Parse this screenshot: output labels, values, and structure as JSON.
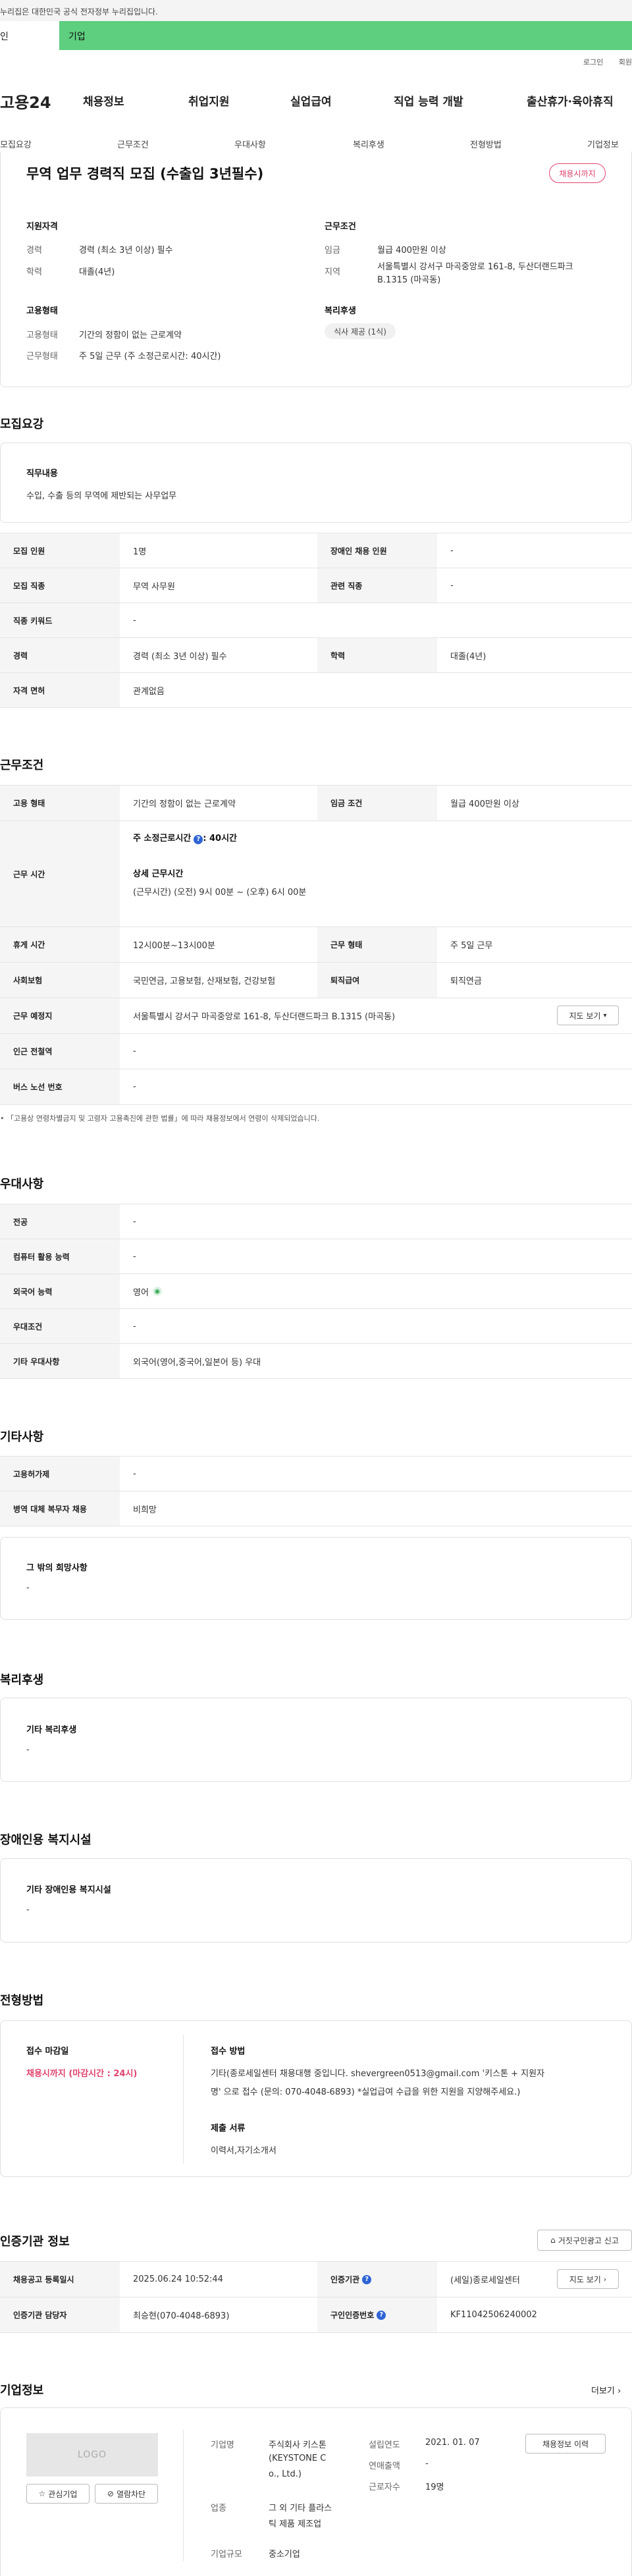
{
  "top": {
    "notice": "이 누리집은 대한민국 공식 전자정부 누리집입니다.",
    "notice_visible": "누리집은 대한민국 공식 전자정부 누리집입니다.",
    "tab_left": "인",
    "tab_right": "기업"
  },
  "util": {
    "login": "로그인",
    "join": "회원"
  },
  "logo": "고용24",
  "gnb": [
    "채용정보",
    "취업지원",
    "실업급여",
    "직업 능력 개발",
    "출산휴가·육아휴직"
  ],
  "subnav": [
    "모집요강",
    "근무조건",
    "우대사항",
    "복리후생",
    "전형방법",
    "기업정보"
  ],
  "summary": {
    "title": "무역 업무 경력직 모집 (수출입 3년필수)",
    "badge": "채용시까지",
    "qual_title": "지원자격",
    "career_lbl": "경력",
    "career_val": "경력 (최소 3년 이상) 필수",
    "edu_lbl": "학력",
    "edu_val": "대졸(4년)",
    "work_title": "근무조건",
    "wage_lbl": "임금",
    "wage_val": "월급 400만원 이상",
    "region_lbl": "지역",
    "region_val1": "서울특별시 강서구 마곡중앙로 161-8, 두산더랜드파크",
    "region_val2": "B.1315 (마곡동)",
    "emp_title": "고용형태",
    "emp_lbl": "고용형태",
    "emp_val": "기간의 정함이 없는 근로계약",
    "shape_lbl": "근무형태",
    "shape_val": "주 5일 근무 (주 소정근로시간: 40시간)",
    "welfare_title": "복리후생",
    "welfare_chip": "식사 제공 (1식)"
  },
  "recruit": {
    "title": "모집요강",
    "duty_title": "직무내용",
    "duty_val": "수입, 수출 등의 무역에 제반되는 사무업무",
    "rows": [
      {
        "th1": "모집 인원",
        "td1": "1명",
        "th2": "장애인 채용 인원",
        "td2": "-"
      },
      {
        "th1": "모집 직종",
        "td1": "무역 사무원",
        "th2": "관련 직종",
        "td2": "-"
      },
      {
        "th1": "직종 키워드",
        "td1": "-"
      },
      {
        "th1": "경력",
        "td1": "경력 (최소 3년 이상) 필수",
        "th2": "학력",
        "td2": "대졸(4년)"
      },
      {
        "th1": "자격 면허",
        "td1": "관계없음"
      }
    ]
  },
  "work": {
    "title": "근무조건",
    "emp_th": "고용 형태",
    "emp_td": "기간의 정함이 없는 근로계약",
    "wage_th": "임금 조건",
    "wage_td": "월급 400만원 이상",
    "time_th": "근무 시간",
    "time_label": "주 소정근로시간",
    "time_val": ": 40시간",
    "detail_label": "상세 근무시간",
    "detail_val": "(근무시간) (오전) 9시 00분 ~ (오후) 6시 00분",
    "rest_th": "휴게 시간",
    "rest_td": "12시00분~13시00분",
    "shape_th": "근무 형태",
    "shape_td": "주 5일 근무",
    "ins_th": "사회보험",
    "ins_td": "국민연금, 고용보험, 산재보험, 건강보험",
    "ret_th": "퇴직급여",
    "ret_td": "퇴직연금",
    "place_th": "근무 예정지",
    "place_td": "서울특별시 강서구 마곡중앙로 161-8, 두산더랜드파크 B.1315 (마곡동)",
    "map_btn": "지도 보기",
    "subway_th": "인근 전철역",
    "subway_td": "-",
    "bus_th": "버스 노선 번호",
    "bus_td": "-",
    "note": "「고용상 연령차별금지 및 고령자 고용촉진에 관한 법률」에 따라 채용정보에서 연령이 삭제되었습니다."
  },
  "pref": {
    "title": "우대사항",
    "rows": [
      {
        "th": "전공",
        "td": "-"
      },
      {
        "th": "컴퓨터 활용 능력",
        "td": "-"
      },
      {
        "th": "외국어 능력",
        "td": "영어"
      },
      {
        "th": "우대조건",
        "td": "-"
      },
      {
        "th": "기타 우대사항",
        "td": "외국어(영어,중국어,일본어 등) 우대"
      }
    ]
  },
  "etc": {
    "title": "기타사항",
    "rows": [
      {
        "th": "고용허가제",
        "td": "-"
      },
      {
        "th": "병역 대체 복무자 채용",
        "td": "비희망"
      }
    ],
    "other_title": "그 밖의 희망사항",
    "other_val": "-"
  },
  "welfare": {
    "title": "복리후생",
    "card_title": "기타 복리후생",
    "card_val": "-"
  },
  "disabled": {
    "title": "장애인용 복지시설",
    "card_title": "기타 장애인용 복지시설",
    "card_val": "-"
  },
  "process": {
    "title": "전형방법",
    "deadline_title": "접수 마감일",
    "deadline_val": "채용시까지 (마감시간 : 24시)",
    "method_title": "접수 방법",
    "method_val1": "기타(종로세일센터 채용대행 중입니다. shevergreen0513@gmail.com '키스톤 + 지원자",
    "method_val2": "명' 으로 접수 (문의: 070-4048-6893) *실업급여 수급을 위한 지원을 지양해주세요.)",
    "docs_title": "제출 서류",
    "docs_val": "이력서,자기소개서"
  },
  "cert": {
    "title": "인증기관 정보",
    "report_btn": "거짓구인광고 신고",
    "reg_th": "채용공고 등록일시",
    "reg_td": "2025.06.24 10:52:44",
    "org_th": "인증기관",
    "org_td": "(세일)종로세일센터",
    "map_btn": "지도 보기",
    "mgr_th": "인증기관 담당자",
    "mgr_td": "최승현(070-4048-6893)",
    "num_th": "구인인증번호",
    "num_td": "KF11042506240002"
  },
  "company": {
    "title": "기업정보",
    "more": "더보기",
    "logo": "LOGO",
    "fav_btn": "관심기업",
    "block_btn": "열람차단",
    "name_lbl": "기업명",
    "name_val1": "주식회사 키스톤",
    "name_val2": "(KEYSTONE C",
    "name_val3": "o., Ltd.)",
    "ind_lbl": "업종",
    "ind_val1": "그 외 기타 플라스",
    "ind_val2": "틱 제품 제조업",
    "size_lbl": "기업규모",
    "size_val": "중소기업",
    "year_lbl": "설립연도",
    "year_val": "2021. 01. 07",
    "sales_lbl": "연매출액",
    "sales_val": "-",
    "emp_lbl": "근로자수",
    "emp_val": "19명",
    "history_btn": "채용정보 이력"
  }
}
